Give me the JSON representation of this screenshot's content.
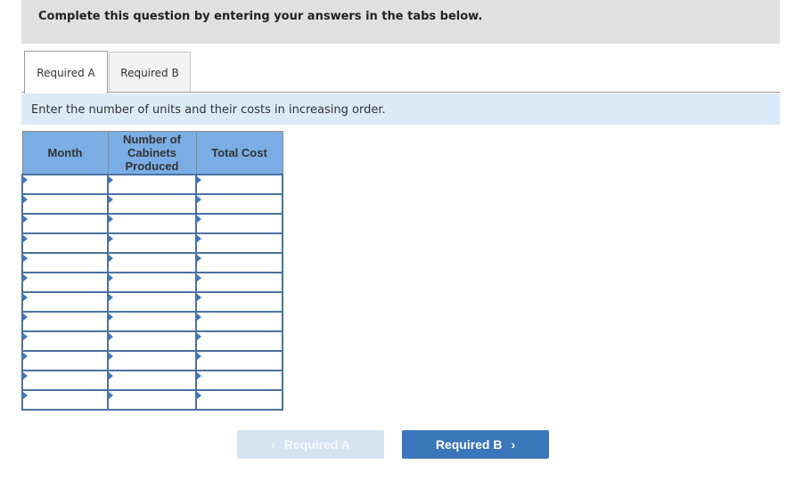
{
  "instruction": "Complete this question by entering your answers in the tabs below.",
  "tabs": [
    {
      "label": "Required A",
      "active": true
    },
    {
      "label": "Required B",
      "active": false
    }
  ],
  "prompt": "Enter the number of units and their costs in increasing order.",
  "table": {
    "headers": [
      "Month",
      "Number of Cabinets Produced",
      "Total Cost"
    ],
    "row_count": 12,
    "rows": [
      [
        "",
        "",
        ""
      ],
      [
        "",
        "",
        ""
      ],
      [
        "",
        "",
        ""
      ],
      [
        "",
        "",
        ""
      ],
      [
        "",
        "",
        ""
      ],
      [
        "",
        "",
        ""
      ],
      [
        "",
        "",
        ""
      ],
      [
        "",
        "",
        ""
      ],
      [
        "",
        "",
        ""
      ],
      [
        "",
        "",
        ""
      ],
      [
        "",
        "",
        ""
      ],
      [
        "",
        "",
        ""
      ]
    ]
  },
  "navigation": {
    "prev_label": "Required A",
    "prev_icon": "chevron-left-icon",
    "prev_disabled": true,
    "next_label": "Required B",
    "next_icon": "chevron-right-icon"
  },
  "colors": {
    "header_bg": "#7aade3",
    "cell_border": "#4a72a0",
    "next_button": "#3c76bb",
    "prev_button_disabled": "#d5e2f1",
    "prompt_band": "#dbeaf7"
  }
}
